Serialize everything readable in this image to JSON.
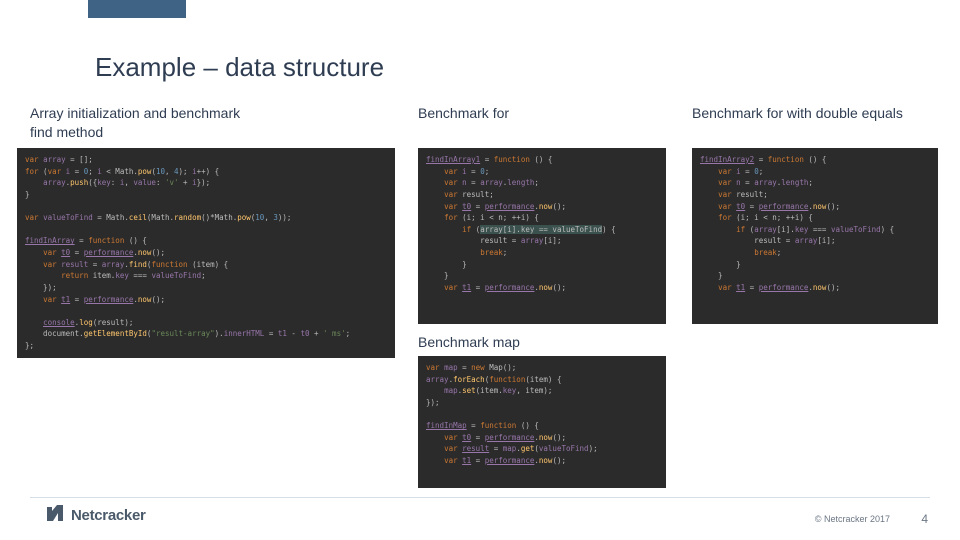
{
  "title": "Example – data structure",
  "labels": {
    "col1": "Array initialization and benchmark find method",
    "col2": "Benchmark for",
    "col3": "Benchmark for with double equals",
    "col4": "Benchmark map"
  },
  "logo_text": "Netcracker",
  "copyright": "© Netcracker 2017",
  "page_number": "4",
  "code": {
    "block1": "var array = [];\nfor (var i = 0; i < Math.pow(10, 4); i++) {\n    array.push({key: i, value: 'v' + i});\n}\n\nvar valueToFind = Math.ceil(Math.random()*Math.pow(10, 3));\n\nfindInArray = function () {\n    var t0 = performance.now();\n    var result = array.find(function (item) {\n        return item.key === valueToFind;\n    });\n    var t1 = performance.now();\n\n    console.log(result);\n    document.getElementById(\"result-array\").innerHTML = t1 - t0 + ' ms';\n};",
    "block2": "findInArray1 = function () {\n    var i = 0;\n    var n = array.length;\n    var result;\n    var t0 = performance.now();\n    for (i; i < n; ++i) {\n        if (array[i].key == valueToFind) {\n            result = array[i];\n            break;\n        }\n    }\n    var t1 = performance.now();",
    "block3": "findInArray2 = function () {\n    var i = 0;\n    var n = array.length;\n    var result;\n    var t0 = performance.now();\n    for (i; i < n; ++i) {\n        if (array[i].key === valueToFind) {\n            result = array[i];\n            break;\n        }\n    }\n    var t1 = performance.now();",
    "block4": "var map = new Map();\narray.forEach(function(item) {\n    map.set(item.key, item);\n});\n\nfindInMap = function () {\n    var t0 = performance.now();\n    var result = map.get(valueToFind);\n    var t1 = performance.now();"
  }
}
